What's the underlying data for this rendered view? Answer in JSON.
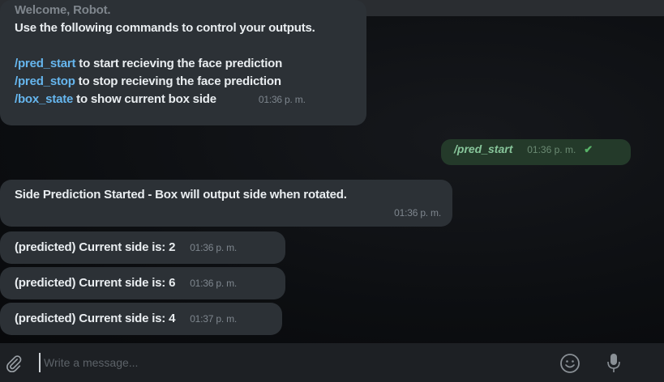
{
  "welcome": {
    "title": "Welcome, Robot.",
    "intro": "Use the following commands to control your outputs.",
    "commands": [
      {
        "cmd": "/pred_start",
        "desc": " to start recieving the face prediction"
      },
      {
        "cmd": "/pred_stop",
        "desc": " to stop recieving the face prediction"
      },
      {
        "cmd": "/box_state",
        "desc": " to show current box side"
      }
    ],
    "time": "01:36 p. m."
  },
  "outgoing": {
    "text": "/pred_start",
    "time": "01:36 p. m.",
    "status": "read"
  },
  "started": {
    "text": "Side Prediction Started - Box will output side when rotated.",
    "time": "01:36 p. m."
  },
  "sides": [
    {
      "text": "(predicted) Current side is: 2",
      "time": "01:36 p. m."
    },
    {
      "text": "(predicted) Current side is: 6",
      "time": "01:36 p. m."
    },
    {
      "text": "(predicted) Current side is: 4",
      "time": "01:37 p. m."
    }
  ],
  "composer": {
    "placeholder": "Write a message..."
  },
  "icons": {
    "attach": "paperclip-icon",
    "emoji": "emoji-icon",
    "mic": "microphone-icon",
    "read": "check-icon"
  },
  "colors": {
    "bubble_in": "#2c3136",
    "bubble_out": "#243a2a",
    "command": "#66b6ee"
  }
}
